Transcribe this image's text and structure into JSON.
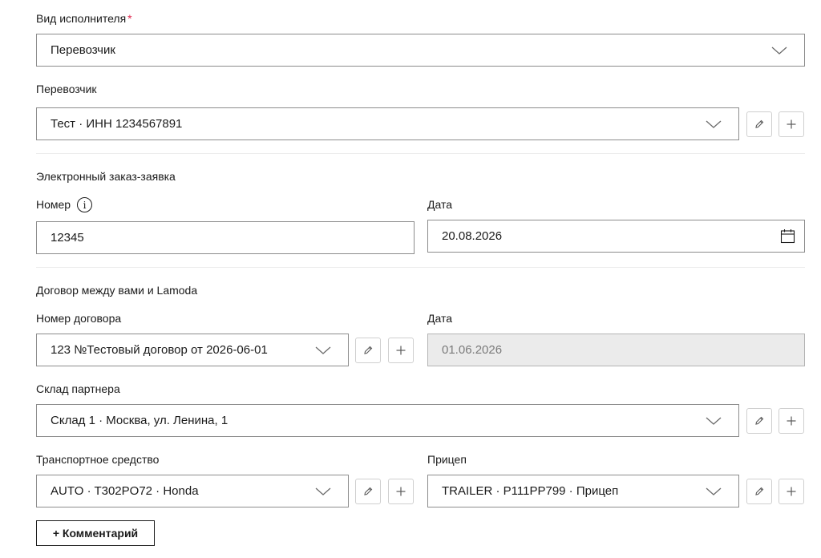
{
  "executor_type": {
    "label": "Вид исполнителя",
    "required_mark": "*",
    "value": "Перевозчик"
  },
  "carrier": {
    "label": "Перевозчик",
    "value": "Тест · ИНН 1234567891"
  },
  "electronic_order": {
    "section_title": "Электронный заказ-заявка",
    "number_label": "Номер",
    "info_glyph": "i",
    "number_value": "12345",
    "date_label": "Дата",
    "date_value": "20.08.2026"
  },
  "contract": {
    "section_title": "Договор между вами и Lamoda",
    "number_label": "Номер договора",
    "number_value": "123 №Тестовый договор от 2026-06-01",
    "date_label": "Дата",
    "date_value": "01.06.2026"
  },
  "warehouse": {
    "label": "Склад партнера",
    "value": "Склад 1 · Москва, ул. Ленина, 1"
  },
  "vehicle": {
    "label": "Транспортное средство",
    "value": "AUTO · T302PO72 · Honda"
  },
  "trailer": {
    "label": "Прицеп",
    "value": "TRAILER · P111PP799 · Прицеп"
  },
  "comment_button": {
    "label": "+ Комментарий"
  },
  "icons": {
    "dropdown": "chevron-down-icon",
    "edit": "pencil-icon",
    "add": "plus-icon",
    "calendar": "calendar-icon",
    "info": "info-icon"
  },
  "colors": {
    "required": "#e0284f",
    "border": "#8c8c8c",
    "disabled_bg": "#ebebeb"
  }
}
